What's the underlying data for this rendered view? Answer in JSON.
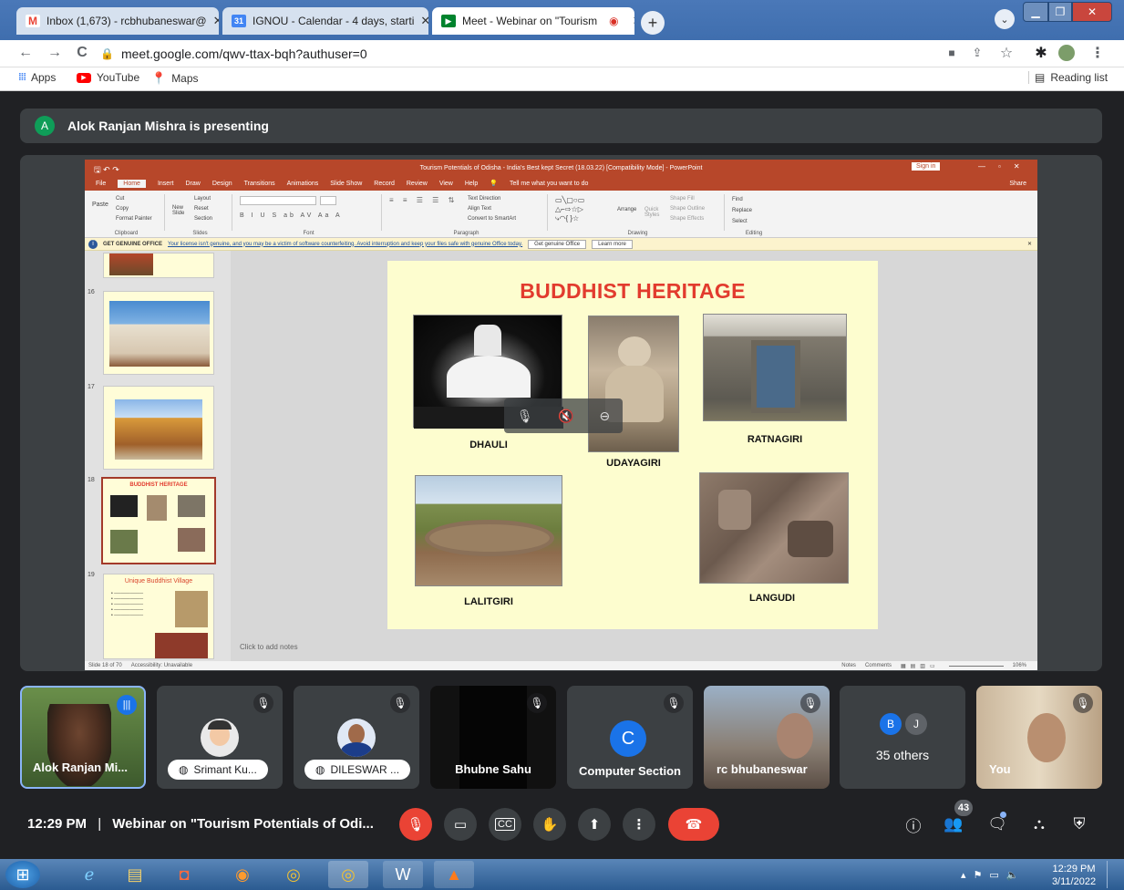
{
  "browser": {
    "tabs": [
      {
        "label": "Inbox (1,673) - rcbhubaneswar@",
        "favicon": "gmail-icon"
      },
      {
        "label": "IGNOU - Calendar - 4 days, starti",
        "favicon": "calendar-icon"
      },
      {
        "label": "Meet - Webinar on \"Tourism",
        "favicon": "meet-icon"
      }
    ],
    "new_tab": "+",
    "url": "meet.google.com/qwv-ttax-bqh?authuser=0",
    "bookmarks": [
      "Apps",
      "YouTube",
      "Maps"
    ],
    "reading_list": "Reading list"
  },
  "meet": {
    "presenter_initial": "A",
    "presenting_text": "Alok Ranjan Mishra is presenting",
    "meeting_time": "12:29 PM",
    "separator": "|",
    "meeting_title": "Webinar on \"Tourism Potentials of Odi...",
    "people_count": "43",
    "tiles": [
      {
        "name": "Alok Ranjan Mi..."
      },
      {
        "name": "Srimant Ku..."
      },
      {
        "name": "DILESWAR ..."
      },
      {
        "name": "Bhubne Sahu"
      },
      {
        "name": "Computer Section",
        "initial": "C"
      },
      {
        "name": "rc bhubaneswar"
      },
      {
        "name": "35 others",
        "initials": [
          "B",
          "J"
        ]
      },
      {
        "name": "You"
      }
    ]
  },
  "ppt": {
    "window_title": "Tourism Potentials of Odisha - India's Best kept Secret (18.03.22) [Compatibility Mode] - PowerPoint",
    "sign_in": "Sign in",
    "menu": [
      "File",
      "Home",
      "Insert",
      "Draw",
      "Design",
      "Transitions",
      "Animations",
      "Slide Show",
      "Record",
      "Review",
      "View",
      "Help"
    ],
    "tell_me": "Tell me what you want to do",
    "share": "Share",
    "ribbon_groups": [
      "Clipboard",
      "Slides",
      "Font",
      "Paragraph",
      "Drawing",
      "Editing"
    ],
    "ribbon_items": {
      "cut": "Cut",
      "copy": "Copy",
      "format_painter": "Format Painter",
      "paste": "Paste",
      "layout": "Layout",
      "reset": "Reset",
      "new_slide": "New Slide",
      "section": "Section",
      "find": "Find",
      "replace": "Replace",
      "select": "Select",
      "arrange": "Arrange",
      "text_direction": "Text Direction",
      "align_text": "Align Text",
      "convert_smartart": "Convert to SmartArt",
      "shape_fill": "Shape Fill",
      "shape_outline": "Shape Outline",
      "shape_effects": "Shape Effects",
      "quick_styles": "Quick Styles"
    },
    "message_bar": {
      "label": "GET GENUINE OFFICE",
      "text": "Your license isn't genuine, and you may be a victim of software counterfeiting. Avoid interruption and keep your files safe with genuine Office today.",
      "btn1": "Get genuine Office",
      "btn2": "Learn more"
    },
    "thumb_numbers": [
      "16",
      "17",
      "18",
      "19"
    ],
    "thumb19_title": "Unique Buddhist Village",
    "slide": {
      "title": "BUDDHIST HERITAGE",
      "captions": [
        "DHAULI",
        "UDAYAGIRI",
        "RATNAGIRI",
        "LALITGIRI",
        "LANGUDI"
      ]
    },
    "notes": "Click to add notes",
    "status_left": "Slide 18 of 70",
    "accessibility": "Accessibility: Unavailable",
    "status_notes": "Notes",
    "status_comments": "Comments",
    "zoom": "106%"
  },
  "taskbar": {
    "time": "12:29 PM",
    "date": "3/11/2022"
  }
}
